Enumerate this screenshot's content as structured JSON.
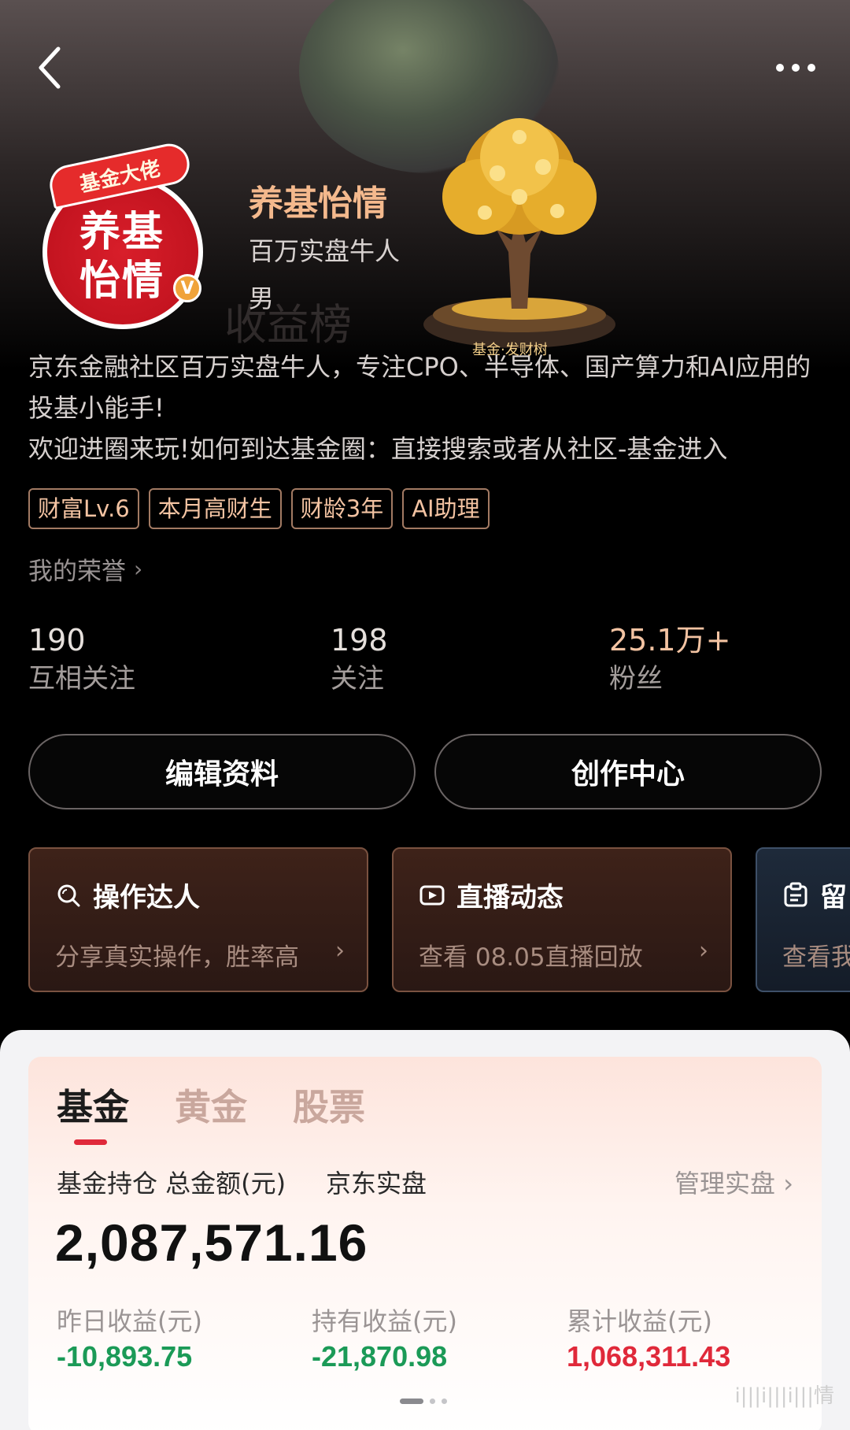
{
  "profile": {
    "name": "养基怡情",
    "title": "百万实盘牛人",
    "gender": "男",
    "avatar_ribbon": "基金大佬",
    "avatar_text_1": "养基",
    "avatar_text_2": "怡情",
    "verified_mark": "V",
    "ghost_text": "收益榜",
    "badge_caption": "基金·发财树",
    "bio_line1": "京东金融社区百万实盘牛人，专注CPO、半导体、国产算力和AI应用的投基小能手!",
    "bio_line2": "欢迎进圈来玩!如何到达基金圈：直接搜索或者从社区-基金进入"
  },
  "tags": [
    "财富Lv.6",
    "本月高财生",
    "财龄3年",
    "AI助理"
  ],
  "honor_label": "我的荣誉",
  "stats": {
    "mutual": {
      "value": "190",
      "label": "互相关注"
    },
    "following": {
      "value": "198",
      "label": "关注"
    },
    "fans": {
      "value": "25.1万+",
      "label": "粉丝"
    }
  },
  "buttons": {
    "edit": "编辑资料",
    "create": "创作中心"
  },
  "cards": [
    {
      "title": "操作达人",
      "sub": "分享真实操作，胜率高",
      "icon": "search-icon"
    },
    {
      "title": "直播动态",
      "sub": "查看 08.05直播回放",
      "icon": "live-video-icon"
    },
    {
      "title": "留",
      "sub": "查看我",
      "icon": "message-board-icon"
    }
  ],
  "portfolio": {
    "tabs": [
      "基金",
      "黄金",
      "股票"
    ],
    "active_tab": "基金",
    "holding_label": "基金持仓 总金额(元)",
    "holding_source": "京东实盘",
    "manage_label": "管理实盘",
    "total": "2,087,571.16",
    "yesterday": {
      "label": "昨日收益(元)",
      "value": "-10,893.75"
    },
    "holding": {
      "label": "持有收益(元)",
      "value": "-21,870.98"
    },
    "cumulative": {
      "label": "累计收益(元)",
      "value": "1,068,311.43"
    },
    "carousel_pages": 3,
    "carousel_current": 1
  },
  "watermark": "i|||i|||i|||情",
  "colors": {
    "accent_name": "#f4b98d",
    "tab_indicator": "#e0293a",
    "loss_green": "#1b9a57",
    "gain_red": "#e0293a"
  }
}
